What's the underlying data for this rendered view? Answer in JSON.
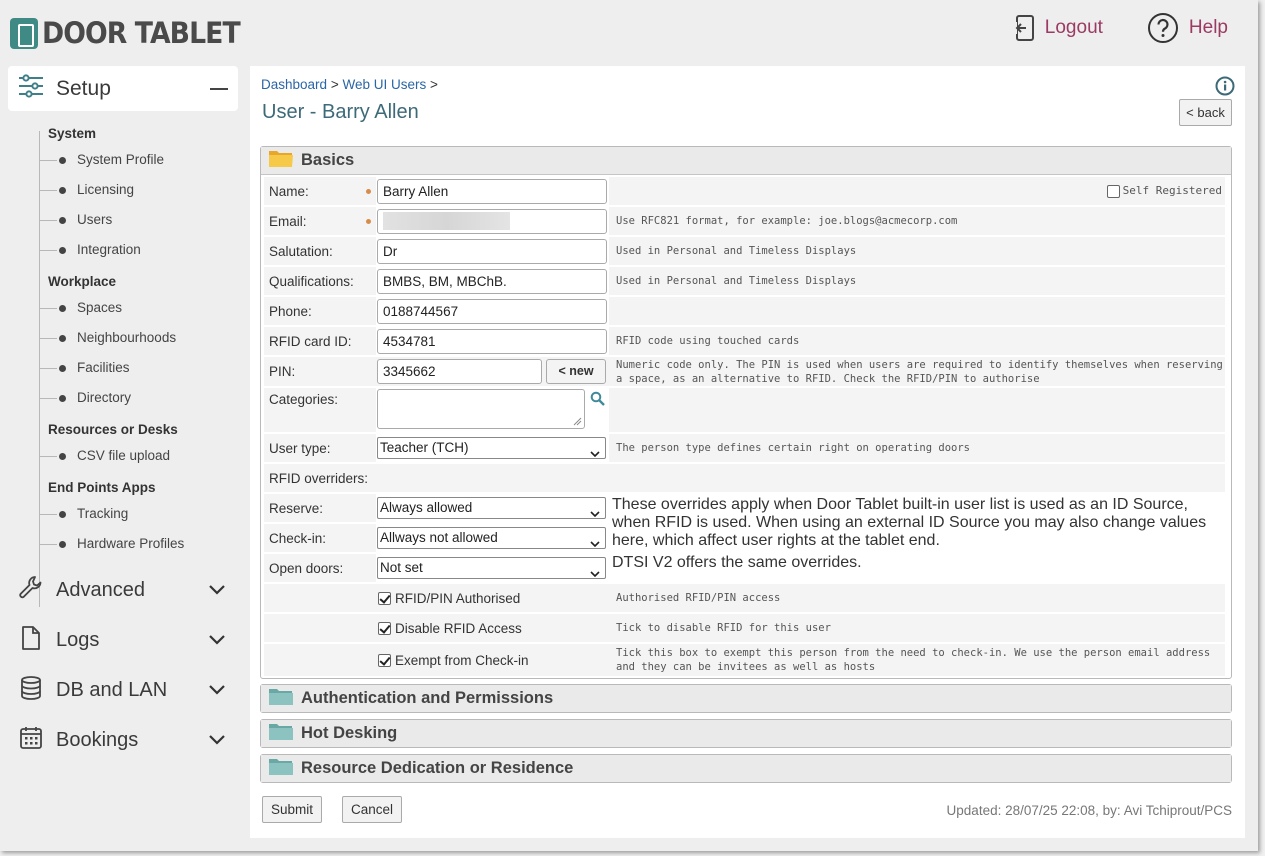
{
  "brand": {
    "name": "DOOR TABLET"
  },
  "header": {
    "logout_label": "Logout",
    "help_label": "Help",
    "accent": "#9b3a62"
  },
  "sidebar": {
    "setup_label": "Setup",
    "groups": [
      {
        "title": "System",
        "items": [
          "System Profile",
          "Licensing",
          "Users",
          "Integration"
        ]
      },
      {
        "title": "Workplace",
        "items": [
          "Spaces",
          "Neighbourhoods",
          "Facilities",
          "Directory"
        ]
      },
      {
        "title": "Resources or Desks",
        "items": [
          "CSV file upload"
        ]
      },
      {
        "title": "End Points Apps",
        "items": [
          "Tracking",
          "Hardware Profiles"
        ]
      }
    ],
    "sections": [
      "Advanced",
      "Logs",
      "DB and LAN",
      "Bookings"
    ]
  },
  "breadcrumb": {
    "dashboard": "Dashboard",
    "sep1": ">",
    "web_ui_users": "Web UI Users",
    "sep2": ">"
  },
  "page_title": "User - Barry Allen",
  "back_label": "< back",
  "basics": {
    "title": "Basics",
    "self_registered_label": "Self Registered",
    "name_label": "Name:",
    "name_value": "Barry Allen",
    "email_label": "Email:",
    "email_help": "Use RFC821 format, for example: joe.blogs@acmecorp.com",
    "salutation_label": "Salutation:",
    "salutation_value": "Dr",
    "salutation_help": "Used in Personal and Timeless Displays",
    "qualifications_label": "Qualifications:",
    "qualifications_value": "BMBS, BM, MBChB.",
    "qualifications_help": "Used in Personal and Timeless Displays",
    "phone_label": "Phone:",
    "phone_value": "0188744567",
    "rfid_label": "RFID card ID:",
    "rfid_value": "4534781",
    "rfid_help": "RFID code using touched cards",
    "pin_label": "PIN:",
    "pin_value": "3345662",
    "new_label": "< new",
    "pin_help": "Numeric code only. The PIN is used when users are required to identify themselves when reserving a space, as an alternative to RFID.  Check the RFID/PIN to authorise",
    "categories_label": "Categories:",
    "user_type_label": "User type:",
    "user_type_value": "Teacher (TCH)",
    "user_type_help": "The person type defines certain right on operating doors",
    "rfid_overriders_label": "RFID overriders:",
    "reserve_label": "Reserve:",
    "reserve_value": "Always allowed",
    "overrides_help": "These overrides apply when Door Tablet built-in user list is used as an ID Source, when RFID is used. When using an external ID Source you may also change values here, which affect user rights at the tablet end.",
    "checkin_label": "Check-in:",
    "checkin_value": "Allways not allowed",
    "open_doors_label": "Open doors:",
    "open_doors_value": "Not set",
    "open_doors_help": "DTSI V2 offers the same overrides.",
    "rfid_pin_auth_label": "RFID/PIN Authorised",
    "rfid_pin_auth_help": "Authorised RFID/PIN access",
    "disable_rfid_label": "Disable RFID Access",
    "disable_rfid_help": "Tick to disable RFID for this user",
    "exempt_label": "Exempt from Check-in",
    "exempt_help": "Tick this box to exempt this person from the need to check-in.  We use the person email address and they can be invitees as well as hosts"
  },
  "collapsed_sections": [
    "Authentication and Permissions",
    "Hot Desking",
    "Resource Dedication or Residence"
  ],
  "footer": {
    "submit_label": "Submit",
    "cancel_label": "Cancel",
    "updated_text": "Updated: 28/07/25 22:08, by: Avi Tchiprout/PCS"
  }
}
